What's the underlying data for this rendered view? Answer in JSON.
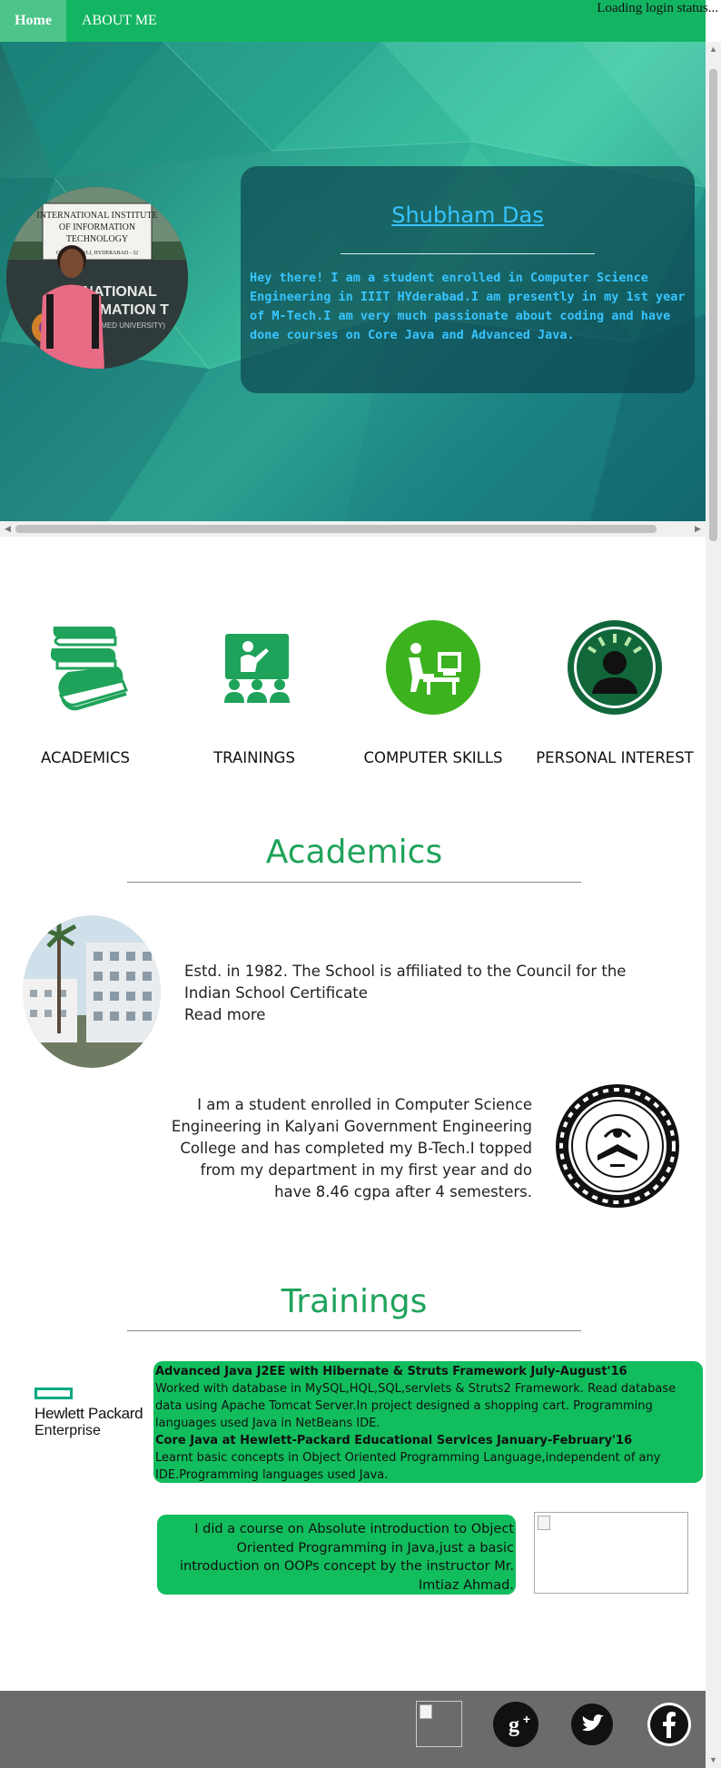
{
  "nav": {
    "home": "Home",
    "about": "ABOUT ME",
    "login_status": "Loading login status..."
  },
  "profile": {
    "name": "Shubham Das",
    "bio": "Hey there! I am a student enrolled in Computer Science Engineering in IIIT HYderabad.I am presently in my 1st year of M-Tech.I am very much passionate about coding and have done courses on Core Java and Advanced Java.",
    "photo_sign": [
      "INTERNATIONAL INSTITUTE",
      "OF INFORMATION",
      "TECHNOLOGY",
      "GACHIBOWLI, HYDERABAD - 32"
    ],
    "photo_banner": [
      "NATIONAL",
      "RMATION T",
      "(DEEMED UNIVERSITY)"
    ]
  },
  "features": [
    {
      "label": "ACADEMICS",
      "icon": "books-icon"
    },
    {
      "label": "TRAININGS",
      "icon": "classroom-icon"
    },
    {
      "label": "COMPUTER SKILLS",
      "icon": "computer-user-icon"
    },
    {
      "label": "PERSONAL INTEREST",
      "icon": "idea-person-icon"
    }
  ],
  "academics": {
    "title": "Academics",
    "school": {
      "text": "Estd. in 1982. The School is affiliated to the Council for the Indian School Certificate",
      "read_more": "Read more"
    },
    "college": {
      "text": "I am a student enrolled in Computer Science Engineering in Kalyani Government Engineering College and has completed my B-Tech.I topped from my department in my first year and do have 8.46 cgpa after 4 semesters."
    }
  },
  "trainings": {
    "title": "Trainings",
    "hp_logo": {
      "line1": "Hewlett Packard",
      "line2": "Enterprise"
    },
    "items": [
      {
        "head": "Advanced Java J2EE with Hibernate & Struts Framework July-August'16",
        "body": "Worked with database in MySQL,HQL,SQL,servlets & Struts2 Framework. Read database data using Apache Tomcat Server.In project designed a shopping cart. Programming languages used Java in NetBeans IDE."
      },
      {
        "head": "Core Java at Hewlett-Packard Educational Services January-February'16",
        "body": "Learnt basic concepts in Object Oriented Programming Language,independent of any IDE.Programming languages used Java."
      }
    ],
    "course": "I did a course on Absolute introduction to Object Oriented Programming in Java,just a basic introduction on OOPs concept by the instructor Mr. Imtiaz Ahmad."
  },
  "footer": {
    "icons": [
      "broken-image-icon",
      "google-plus-icon",
      "twitter-icon",
      "facebook-icon"
    ]
  },
  "colors": {
    "nav": "#13b562",
    "accent": "#1fa35a",
    "bio_text": "#37c4ff",
    "box": "#11bd5d",
    "footer": "#6b6b6b"
  }
}
